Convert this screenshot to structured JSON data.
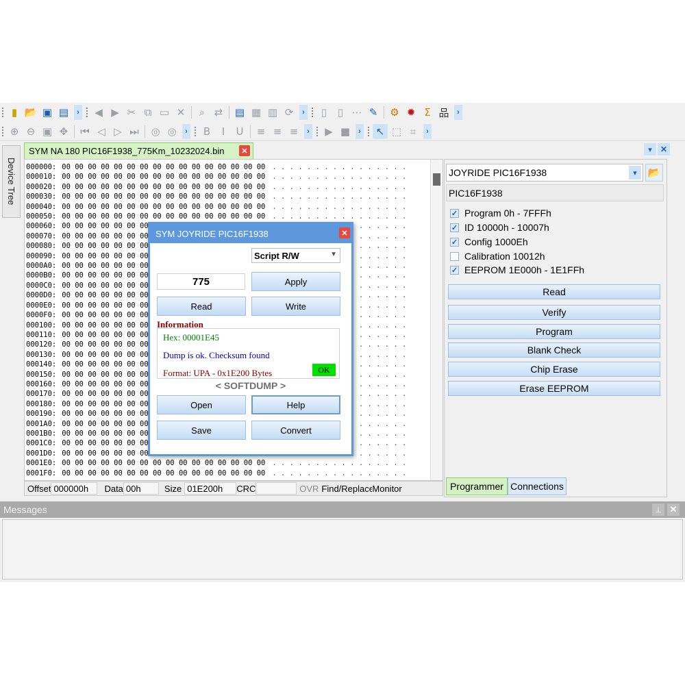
{
  "toolbar1": {
    "icons": [
      "chip-icon",
      "open-folder-icon",
      "save-icon",
      "save-as-icon",
      "undo-icon",
      "redo-icon",
      "cut-icon",
      "copy-icon",
      "paste-icon",
      "delete-icon",
      "find-icon",
      "replace-icon",
      "document-icon",
      "hex-view-icon",
      "binary-view-icon",
      "refresh-icon",
      "page-icon",
      "page2-icon",
      "grid-icon",
      "edit-icon",
      "script-icon",
      "bug-icon",
      "sigma-icon",
      "network-icon"
    ]
  },
  "toolbar2": {
    "icons": [
      "zoom-in-icon",
      "zoom-out-icon",
      "fit-icon",
      "move-icon",
      "first-icon",
      "prev-icon",
      "next-icon",
      "last-icon",
      "back-icon",
      "forward-icon",
      "bold-icon",
      "italic-icon",
      "underline-icon",
      "align-left-icon",
      "align-center-icon",
      "align-right-icon",
      "play-icon",
      "stop-icon",
      "pointer-icon",
      "select-icon",
      "crop-icon"
    ]
  },
  "side_tab": {
    "label": "Device Tree"
  },
  "file_tab": {
    "label": "SYM NA 180 PIC16F1938_775Km_10232024.bin"
  },
  "hex": {
    "row_data": "00 00 00 00 00 00 00 00 00 00 00 00 00 00 00 00",
    "ascii": ". . . . . . . . . . . . . . . .",
    "offsets": [
      "000000:",
      "000010:",
      "000020:",
      "000030:",
      "000040:",
      "000050:",
      "000060:",
      "000070:",
      "000080:",
      "000090:",
      "0000A0:",
      "0000B0:",
      "0000C0:",
      "0000D0:",
      "0000E0:",
      "0000F0:",
      "000100:",
      "000110:",
      "000120:",
      "000130:",
      "000140:",
      "000150:",
      "000160:",
      "000170:",
      "000180:",
      "000190:",
      "0001A0:",
      "0001B0:",
      "0001C0:",
      "0001D0:",
      "0001E0:",
      "0001F0:"
    ]
  },
  "status": {
    "offset_label": "Offset",
    "offset_value": "000000h",
    "data_label": "Data",
    "data_value": "00h",
    "size_label": "Size",
    "size_value": "01E200h",
    "crc_label": "CRC",
    "crc_value": "",
    "ovr": "OVR",
    "find_replace": "Find/Replace",
    "monitor": "Monitor"
  },
  "programmer": {
    "device": "JOYRIDE PIC16F1938",
    "chip": "PIC16F1938",
    "memory": [
      {
        "label": "Program 0h - 7FFFh",
        "checked": true
      },
      {
        "label": "ID 10000h - 10007h",
        "checked": true
      },
      {
        "label": "Config 1000Eh",
        "checked": true
      },
      {
        "label": "Calibration 10012h",
        "checked": false
      },
      {
        "label": "EEPROM 1E000h - 1E1FFh",
        "checked": true
      }
    ],
    "buttons": [
      "Read",
      "Verify",
      "Program",
      "Blank Check",
      "Chip Erase",
      "Erase EEPROM"
    ],
    "tab_programmer": "Programmer",
    "tab_connections": "Connections"
  },
  "messages": {
    "title": "Messages"
  },
  "dialog": {
    "title": "SYM JOYRIDE PIC16F1938",
    "script": "Script R/W",
    "value": "775",
    "apply": "Apply",
    "read": "Read",
    "write": "Write",
    "info_label": "Information",
    "hex_line": "Hex: 00001E45",
    "dump_line": "Dump is ok. Checksum found",
    "format_line": "Format: UPA - 0x1E200 Bytes",
    "ok": "OK",
    "brand": "< SOFTDUMP >",
    "open": "Open",
    "help": "Help",
    "save": "Save",
    "convert": "Convert"
  },
  "colors": {
    "tab_green": "#d6f2c4",
    "dialog_blue": "#5d98dc",
    "close_red": "#e9493a",
    "ok_green": "#00e000",
    "info_red": "#8b0000",
    "hex_green": "#008000",
    "dump_blue": "#0000cd"
  }
}
